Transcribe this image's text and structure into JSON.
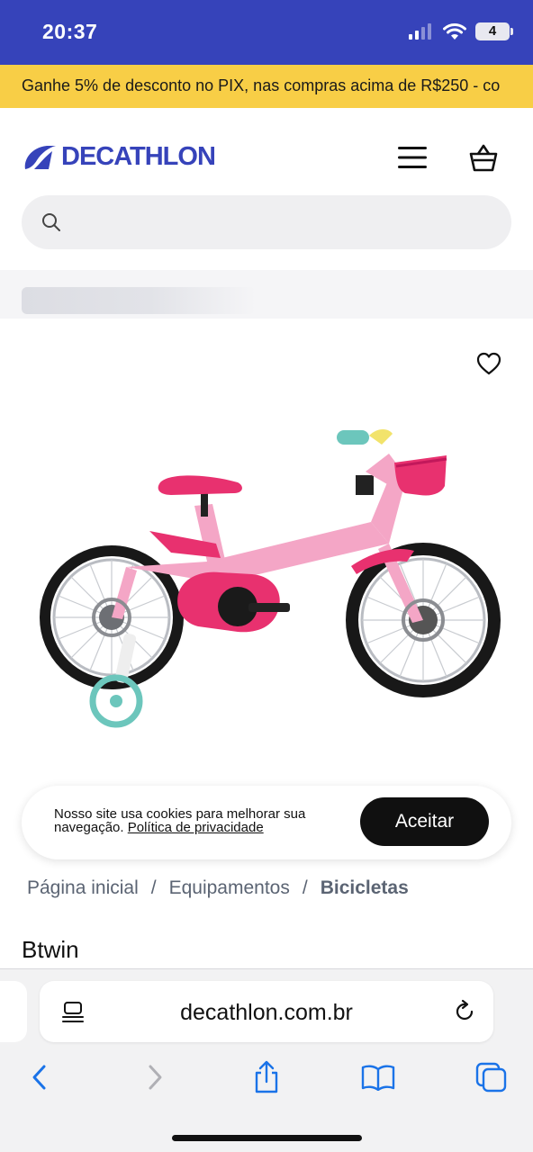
{
  "status_bar": {
    "time": "20:37",
    "battery": "4"
  },
  "promo": {
    "text": "Ganhe 5% de desconto no PIX, nas compras acima de R$250 - co"
  },
  "header": {
    "logo": "DECATHLON",
    "search_placeholder": ""
  },
  "cookie": {
    "text": "Nosso site usa cookies para melhorar sua navegação.",
    "link": "Política de privacidade",
    "accept": "Aceitar"
  },
  "breadcrumb": {
    "items": [
      "Página inicial",
      "Equipamentos",
      "Bicicletas"
    ],
    "separator": "/"
  },
  "product": {
    "brand": "Btwin"
  },
  "browser": {
    "url": "decathlon.com.br"
  },
  "colors": {
    "brand_blue": "#3643ba",
    "promo_yellow": "#f8ce46",
    "bike_pink": "#f4a6c6"
  }
}
